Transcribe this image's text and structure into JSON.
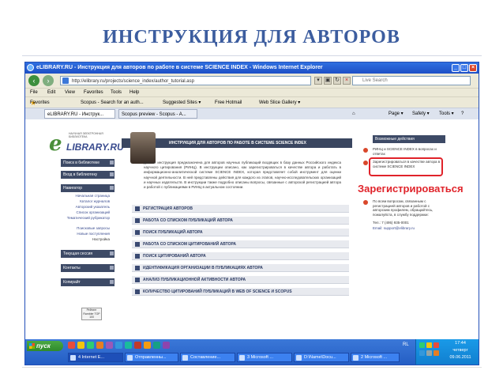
{
  "slide": {
    "title": "ИНСТРУКЦИЯ ДЛЯ АВТОРОВ"
  },
  "browser": {
    "window_title": "eLIBRARY.RU - Инструкция для авторов по работе в системе SCIENCE INDEX - Windows Internet Explorer",
    "address": "http://elibrary.ru/projects/science_index/author_tutorial.asp",
    "search_placeholder": "Live Search",
    "menu": [
      "File",
      "Edit",
      "View",
      "Favorites",
      "Tools",
      "Help"
    ],
    "favorites_bar": {
      "favorites_label": "Favorites",
      "items": [
        "Scopus - Search for an auth...",
        "Suggested Sites ▾",
        "Free Hotmail",
        "Web Slice Gallery ▾"
      ]
    },
    "tabs": [
      "eLIBRARY.RU - Инструк...",
      "Scopus preview - Scopus - A..."
    ],
    "commands": [
      "Page ▾",
      "Safety ▾",
      "Tools ▾"
    ]
  },
  "page": {
    "logo": {
      "letter": "e",
      "name": "LIBRARY.RU",
      "subtitle": "НАУЧНАЯ ЭЛЕКТРОННАЯ БИБЛИОТЕКА"
    },
    "banner": "ИНСТРУКЦИЯ ДЛЯ АВТОРОВ ПО РАБОТЕ В СИСТЕМЕ SCIENCE INDEX",
    "intro_text": "Данная инструкция предназначена для авторов научных публикаций входящих в базу данных Российского индекса научного цитирования (РИНЦ). В инструкции описано, как зарегистрироваться в качестве автора и работать в информационно-аналитической системе SCIENCE INDEX, которая представляет собой инструмент для оценки научной деятельности. В ней представлены действия для каждого из этапов, научно-исследовательских организаций и научных издательств. В инструкции также подробно описаны вопросы, связанные с авторской регистрацией автора и работой с публикациями в РИНЦ в актуальном состоянии.",
    "sidebar": {
      "search_head": "Поиск в библиотеке",
      "login_head": "Вход в библиотеку",
      "nav_head": "Навигатор",
      "nav_links": [
        "Начальная страница",
        "Каталог журналов",
        "Авторский указатель",
        "Список организаций",
        "Тематический рубрикатор",
        "Поисковые запросы",
        "Новые поступления",
        "Настройка"
      ],
      "session_head": "Текущая сессия",
      "contacts_head": "Контакты",
      "copyright_head": "Копирайт",
      "badge": "Рейтинг Rambler TOP 100"
    },
    "sections": [
      "РЕГИСТРАЦИЯ АВТОРОВ",
      "РАБОТА СО СПИСКОМ ПУБЛИКАЦИЙ АВТОРА",
      "ПОИСК ПУБЛИКАЦИЙ АВТОРА",
      "РАБОТА СО СПИСКОМ ЦИТИРОВАНИЙ АВТОРА",
      "ПОИСК ЦИТИРОВАНИЙ АВТОРА",
      "ИДЕНТИФИКАЦИЯ ОРГАНИЗАЦИИ В ПУБЛИКАЦИЯХ АВТОРА",
      "АНАЛИЗ ПУБЛИКАЦИОННОЙ АКТИВНОСТИ АВТОРА",
      "КОЛИЧЕСТВО ЦИТИРОВАНИЙ ПУБЛИКАЦИЙ В WEB OF SCIENCE И SCOPUS"
    ],
    "right_panel": {
      "head": "Возможные действия",
      "item1": "РИНЦ и SCIENCE INDEX в вопросах и ответах",
      "item2": "Зарегистрироваться в качестве автора в системе SCIENCE INDEX",
      "help_text": "По всем вопросам, связанным с регистрацией авторов и работой с авторским профилем, обращайтесь, пожалуйста, в службу поддержки:",
      "phone": "Тел.: 7 (495) 935-0001",
      "email": "Email: support@elibrary.ru"
    },
    "register_callout": "Зарегистрироваться"
  },
  "taskbar": {
    "start": "пуск",
    "buttons": [
      "4 Internet E...",
      "Отправленны...",
      "Составление...",
      "3 Microsoft ...",
      "D:\\Name\\Docu...",
      "2 Microsoft ..."
    ],
    "lang": "RL",
    "time": "17:44",
    "day": "четверг",
    "date": "09.06.2011"
  },
  "colors": {
    "title_blue": "#3c5d9f",
    "accent_red": "#e0232a",
    "nav_dark": "#3d4a66",
    "xp_blue": "#245ec4"
  }
}
